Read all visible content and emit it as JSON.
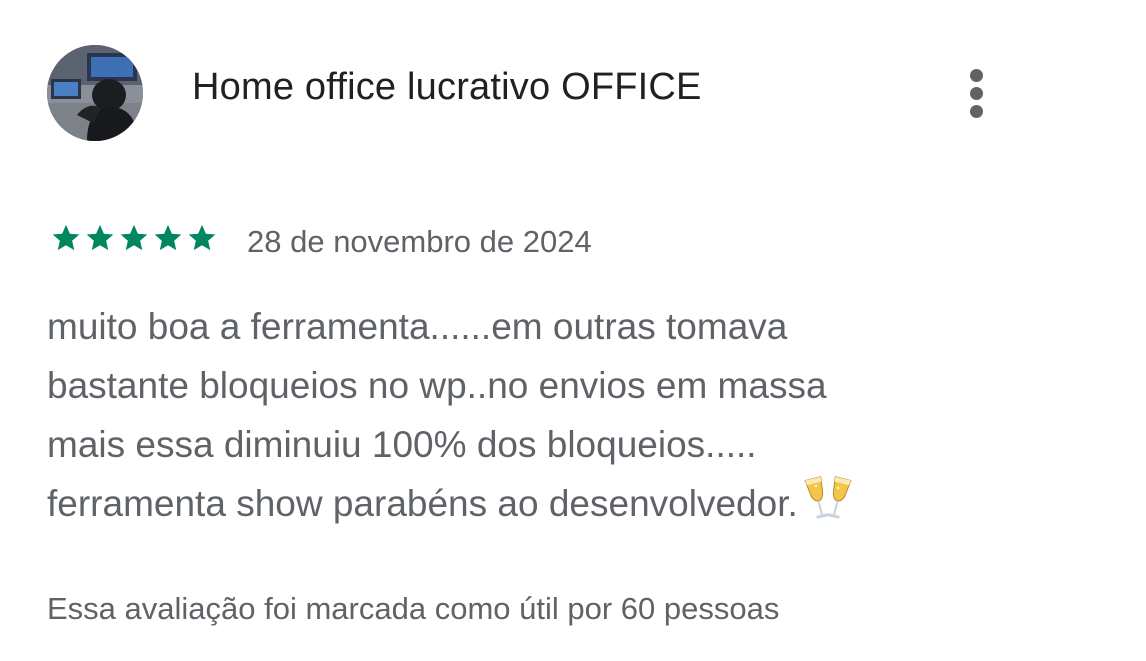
{
  "review": {
    "author_name": "Home office lucrativo OFFICE",
    "more_icon": "more-vert-icon",
    "rating": 5,
    "rating_max": 5,
    "star_color": "#01875f",
    "date": "28 de novembro de 2024",
    "body_lines": [
      "muito boa a ferramenta......em outras tomava",
      "bastante bloqueios no wp..no envios em massa",
      "mais essa diminuiu 100% dos bloqueios.....",
      "ferramenta show parabéns ao desenvolvedor."
    ],
    "body_emoji": "🥂",
    "helpful_text": "Essa avaliação foi marcada como útil por 60 pessoas"
  }
}
